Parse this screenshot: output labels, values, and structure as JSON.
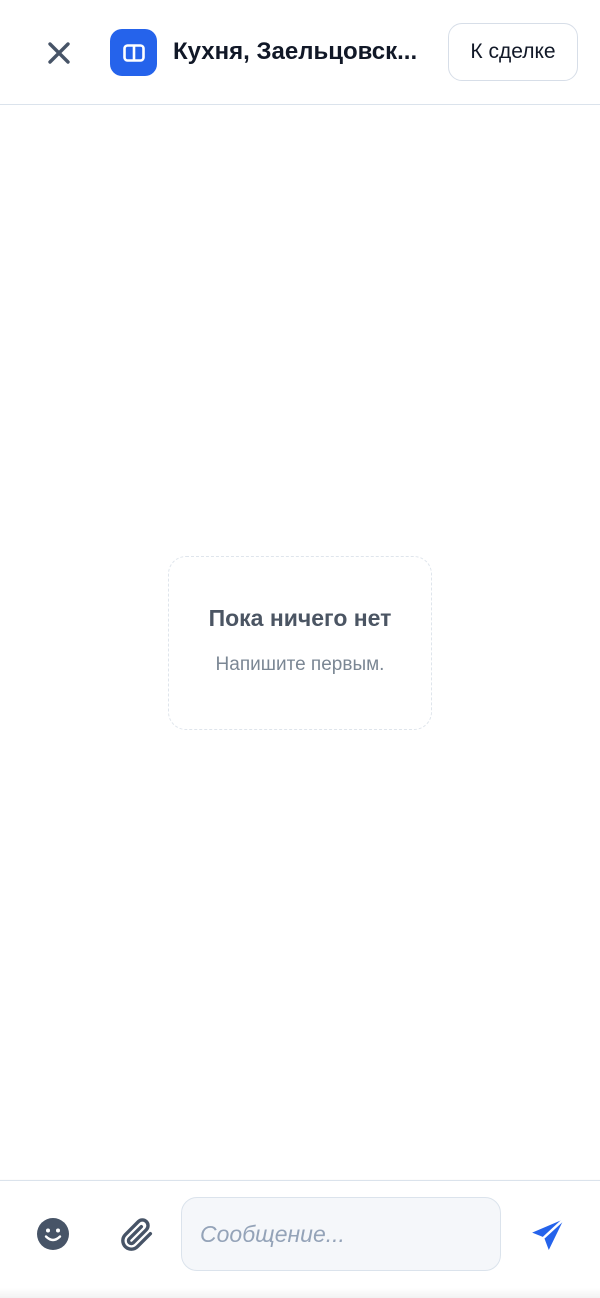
{
  "header": {
    "title": "Кухня, Заельцовск...",
    "deal_button_label": "К сделке",
    "close_icon": "close-icon",
    "deal_icon": "columns-icon"
  },
  "empty_state": {
    "title": "Пока ничего нет",
    "subtitle": "Напишите первым."
  },
  "composer": {
    "message_value": "",
    "message_placeholder": "Сообщение...",
    "emoji_icon": "emoji-icon",
    "attach_icon": "paperclip-icon",
    "send_icon": "send-icon"
  },
  "colors": {
    "accent": "#2563eb",
    "icon_dark": "#475467",
    "border": "#dbe3ec"
  }
}
